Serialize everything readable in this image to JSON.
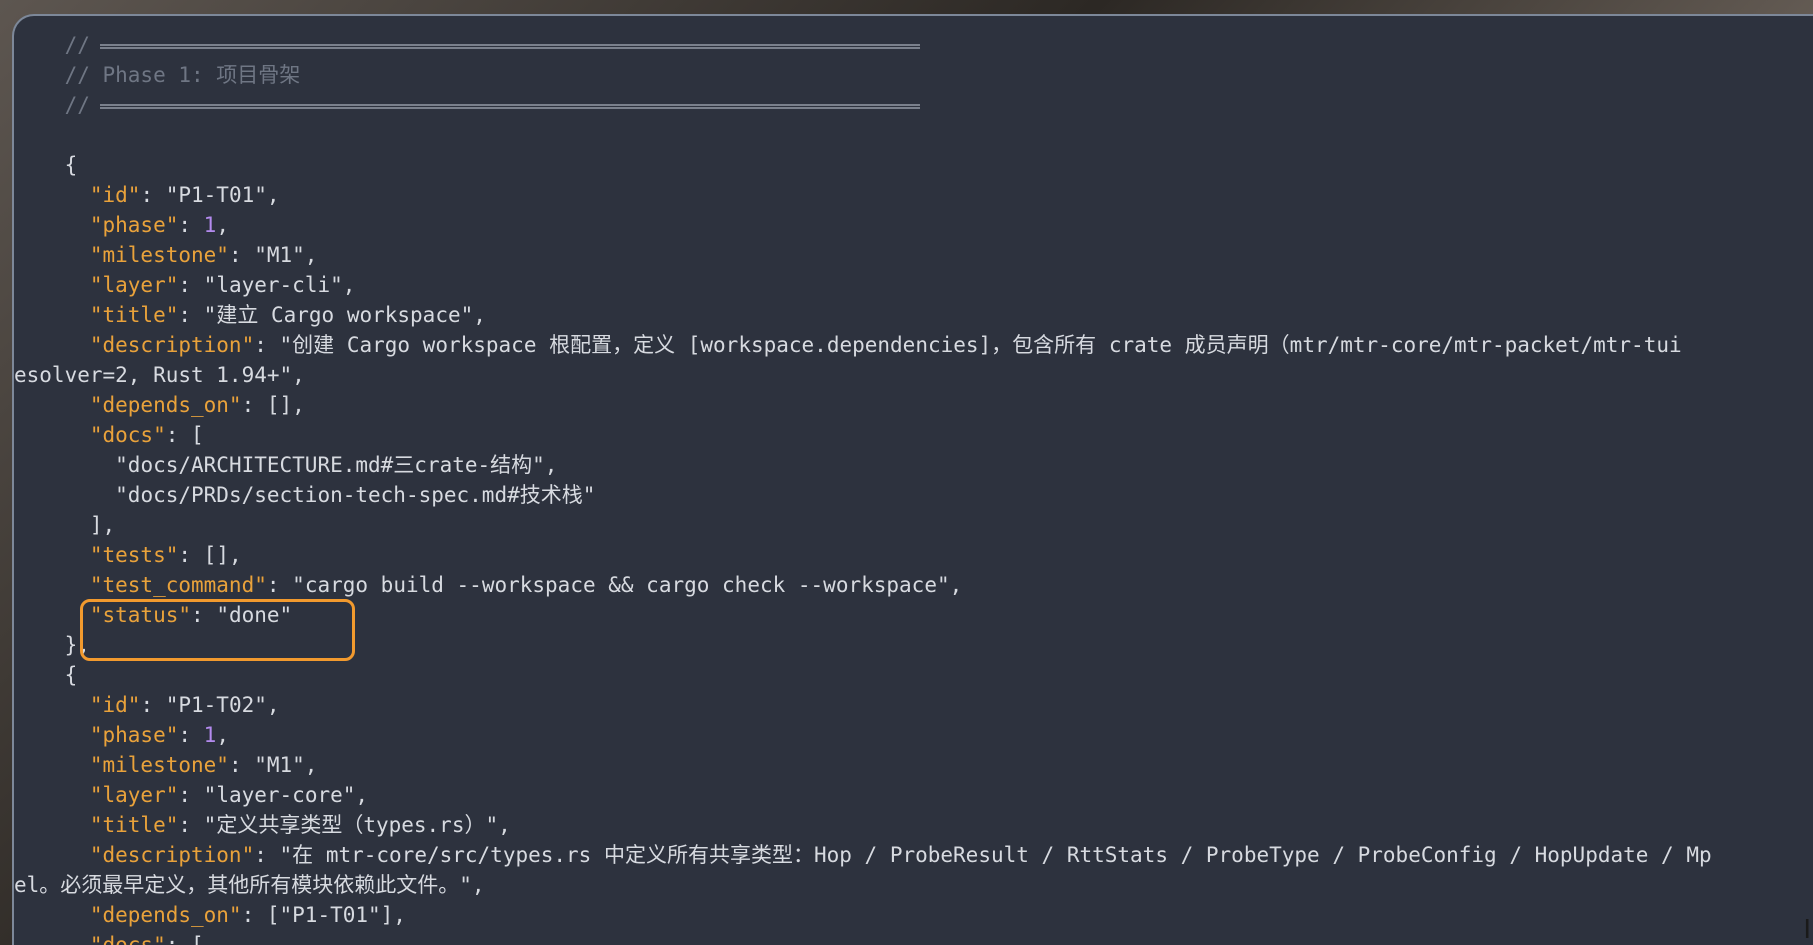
{
  "editor": {
    "header": {
      "comment_prefix": "//",
      "phase_title": "// Phase 1: 项目骨架"
    },
    "task1": {
      "open_brace": "{",
      "id_key": "\"id\"",
      "id_val": "\"P1-T01\",",
      "phase_key": "\"phase\"",
      "phase_val": "1",
      "milestone_key": "\"milestone\"",
      "milestone_val": "\"M1\",",
      "layer_key": "\"layer\"",
      "layer_val": "\"layer-cli\",",
      "title_key": "\"title\"",
      "title_val": "\"建立 Cargo workspace\",",
      "description_key": "\"description\"",
      "description_val": "\"创建 Cargo workspace 根配置，定义 [workspace.dependencies]，包含所有 crate 成员声明（mtr/mtr-core/mtr-packet/mtr-tui",
      "description_wrap": "esolver=2, Rust 1.94+\",",
      "depends_on_key": "\"depends_on\"",
      "depends_on_val": "[],",
      "docs_key": "\"docs\"",
      "docs_open": "[",
      "docs_items": [
        "\"docs/ARCHITECTURE.md#三crate-结构\",",
        "\"docs/PRDs/section-tech-spec.md#技术栈\""
      ],
      "docs_close": "],",
      "tests_key": "\"tests\"",
      "tests_val": "[],",
      "test_command_key": "\"test_command\"",
      "test_command_val": "\"cargo build --workspace && cargo check --workspace\",",
      "status_key": "\"status\"",
      "status_val": "\"done\"",
      "close_brace": "},"
    },
    "task2": {
      "open_brace": "{",
      "id_key": "\"id\"",
      "id_val": "\"P1-T02\",",
      "phase_key": "\"phase\"",
      "phase_val": "1",
      "milestone_key": "\"milestone\"",
      "milestone_val": "\"M1\",",
      "layer_key": "\"layer\"",
      "layer_val": "\"layer-core\",",
      "title_key": "\"title\"",
      "title_val": "\"定义共享类型（types.rs）\",",
      "description_key": "\"description\"",
      "description_val": "\"在 mtr-core/src/types.rs 中定义所有共享类型：Hop / ProbeResult / RttStats / ProbeType / ProbeConfig / HopUpdate / Mp",
      "description_wrap": "el。必须最早定义，其他所有模块依赖此文件。\",",
      "depends_on_key": "\"depends_on\"",
      "depends_on_val": "[\"P1-T01\"],",
      "docs_key": "\"docs\"",
      "docs_open": "["
    }
  },
  "colors": {
    "background": "#2d323e",
    "key": "#e9a23b",
    "number": "#b48bef",
    "comment": "#6f7684",
    "highlight": "#f29a2e"
  }
}
